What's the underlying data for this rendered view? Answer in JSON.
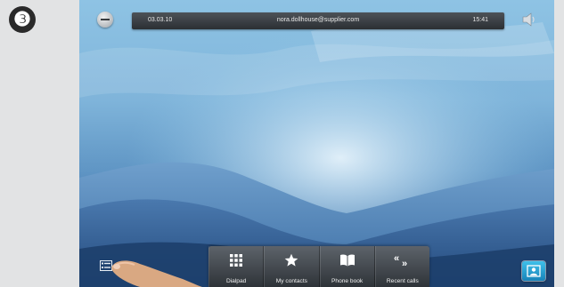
{
  "step_badge": "❸",
  "status_bar": {
    "date": "03.03.10",
    "user": "nora.dollhouse@supplier.com",
    "time": "15:41"
  },
  "icons": {
    "minus": "minus-circle-icon",
    "speaker": "speaker-icon",
    "list": "list-view-icon",
    "contact": "contact-card-icon"
  },
  "dock": [
    {
      "label": "Dialpad",
      "icon": "dialpad-icon"
    },
    {
      "label": "My contacts",
      "icon": "star-icon"
    },
    {
      "label": "Phone book",
      "icon": "book-icon"
    },
    {
      "label": "Recent calls",
      "icon": "recent-calls-icon"
    }
  ],
  "colors": {
    "page_bg": "#e2e3e4",
    "accent_button": "#1f9ad1",
    "dock_bg": "#3b4046"
  }
}
